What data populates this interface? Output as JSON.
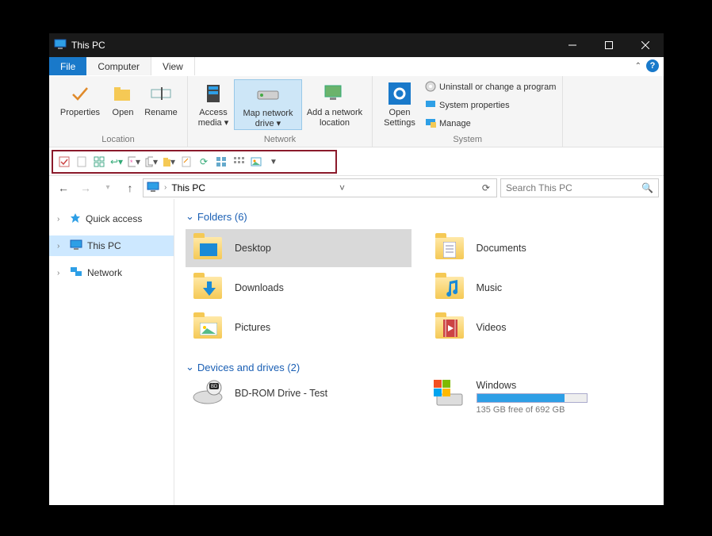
{
  "window": {
    "title": "This PC"
  },
  "tabs": {
    "file": "File",
    "computer": "Computer",
    "view": "View"
  },
  "ribbon": {
    "location": {
      "label": "Location",
      "properties": "Properties",
      "open": "Open",
      "rename": "Rename"
    },
    "network": {
      "label": "Network",
      "access_media": "Access media ▾",
      "map_drive": "Map network drive ▾",
      "add_location": "Add a network location"
    },
    "system": {
      "label": "System",
      "open_settings": "Open Settings",
      "uninstall": "Uninstall or change a program",
      "props": "System properties",
      "manage": "Manage"
    }
  },
  "address": {
    "location": "This PC"
  },
  "search": {
    "placeholder": "Search This PC"
  },
  "nav": {
    "quick": "Quick access",
    "thispc": "This PC",
    "network": "Network"
  },
  "sections": {
    "folders": {
      "title": "Folders (6)",
      "items": [
        "Desktop",
        "Documents",
        "Downloads",
        "Music",
        "Pictures",
        "Videos"
      ]
    },
    "drives": {
      "title": "Devices and drives (2)",
      "bdrom": "BD-ROM Drive - Test",
      "win": {
        "name": "Windows",
        "free": "135 GB free of 692 GB",
        "used_pct": 80
      }
    }
  }
}
